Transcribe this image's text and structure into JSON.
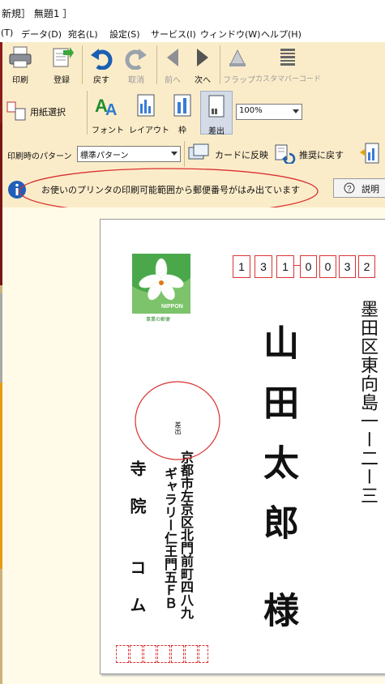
{
  "window": {
    "title": "新規］ 無題1 ］"
  },
  "menu": [
    "(T)",
    "データ(D)",
    "宛名(L)",
    "設定(S)",
    "サービス(I)",
    "ウィンドウ(W)",
    "ヘルプ(H)"
  ],
  "toolbar1": {
    "print": "印刷",
    "register": "登録",
    "undo": "戻す",
    "redo": "取消",
    "prev": "前へ",
    "next": "次へ",
    "flap": "フラップ",
    "barcode": "カスタマバーコード"
  },
  "toolbar2": {
    "paper_select": "用紙選択",
    "font": "フォント",
    "layout": "レイアウト",
    "frame": "枠",
    "sender": "差出",
    "zoom": "100%"
  },
  "toolbar3": {
    "pattern_label": "印刷時のパターン",
    "pattern_value": "標準パターン",
    "apply_card": "カードに反映",
    "reset_recommended": "推奨に戻す"
  },
  "info": {
    "message": "お使いのプリンタの印刷可能範囲から郵便番号がはみ出ています",
    "help_button": "説明"
  },
  "card": {
    "stamp_text": "NIPPON",
    "stamp_caption": "事業の郵便",
    "postal_code": [
      "1",
      "3",
      "1",
      "0",
      "0",
      "3",
      "2"
    ],
    "recipient_address": "墨田区東向島一ー二ー三",
    "recipient_name": "山田太郎",
    "honorific": "様",
    "sender_address_line1": "京都市左京区北門前町四八九",
    "sender_address_line2": "ギャラリー仁王門五ＦＢ",
    "sender_name_line1": "寺院",
    "sender_name_line2": "コム",
    "sender_small_text": "差出"
  },
  "colors": {
    "toolbar": "#fbecc9",
    "warning_oval": "#d93030",
    "stamp_green": "#4aa84a",
    "postal_box": "#d33333"
  }
}
